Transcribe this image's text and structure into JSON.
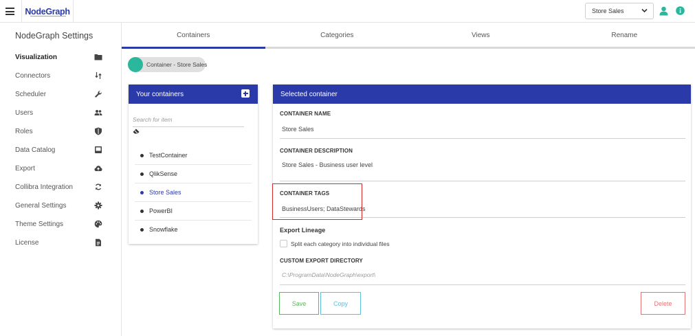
{
  "app": {
    "brand": "NodeGraph",
    "selected_container": "Store Sales"
  },
  "sidebar": {
    "title": "NodeGraph Settings",
    "items": [
      {
        "label": "Visualization",
        "icon": "folder-icon"
      },
      {
        "label": "Connectors",
        "icon": "swap-vertical-icon"
      },
      {
        "label": "Scheduler",
        "icon": "wrench-icon"
      },
      {
        "label": "Users",
        "icon": "users-icon"
      },
      {
        "label": "Roles",
        "icon": "shield-icon"
      },
      {
        "label": "Data Catalog",
        "icon": "inbox-icon"
      },
      {
        "label": "Export",
        "icon": "cloud-upload-icon"
      },
      {
        "label": "Collibra Integration",
        "icon": "sync-icon"
      },
      {
        "label": "General Settings",
        "icon": "gear-icon"
      },
      {
        "label": "Theme Settings",
        "icon": "palette-icon"
      },
      {
        "label": "License",
        "icon": "document-icon"
      }
    ]
  },
  "tabs": [
    {
      "label": "Containers"
    },
    {
      "label": "Categories"
    },
    {
      "label": "Views"
    },
    {
      "label": "Rename"
    }
  ],
  "chip": {
    "label": "Container - Store Sales"
  },
  "containers_panel": {
    "title": "Your containers",
    "search_placeholder": "Search for item",
    "items": [
      "TestContainer",
      "QlikSense",
      "Store Sales",
      "PowerBI",
      "Snowflake"
    ]
  },
  "selected_panel": {
    "title": "Selected container",
    "name_label": "CONTAINER NAME",
    "name_value": "Store Sales",
    "description_label": "CONTAINER DESCRIPTION",
    "description_value": "Store Sales - Business user level",
    "tags_label": "CONTAINER TAGS",
    "tags_value": "BusinessUsers; DataStewards",
    "export_lineage_label": "Export Lineage",
    "split_label": "Split each category into individual files",
    "export_dir_label": "CUSTOM EXPORT DIRECTORY",
    "export_dir_placeholder": "C:\\ProgramData\\NodeGraph\\export\\",
    "save_label": "Save",
    "copy_label": "Copy",
    "delete_label": "Delete"
  },
  "colors": {
    "primary": "#2a3aa8",
    "accent": "#2ab79b",
    "highlight": "#d62a2a"
  }
}
